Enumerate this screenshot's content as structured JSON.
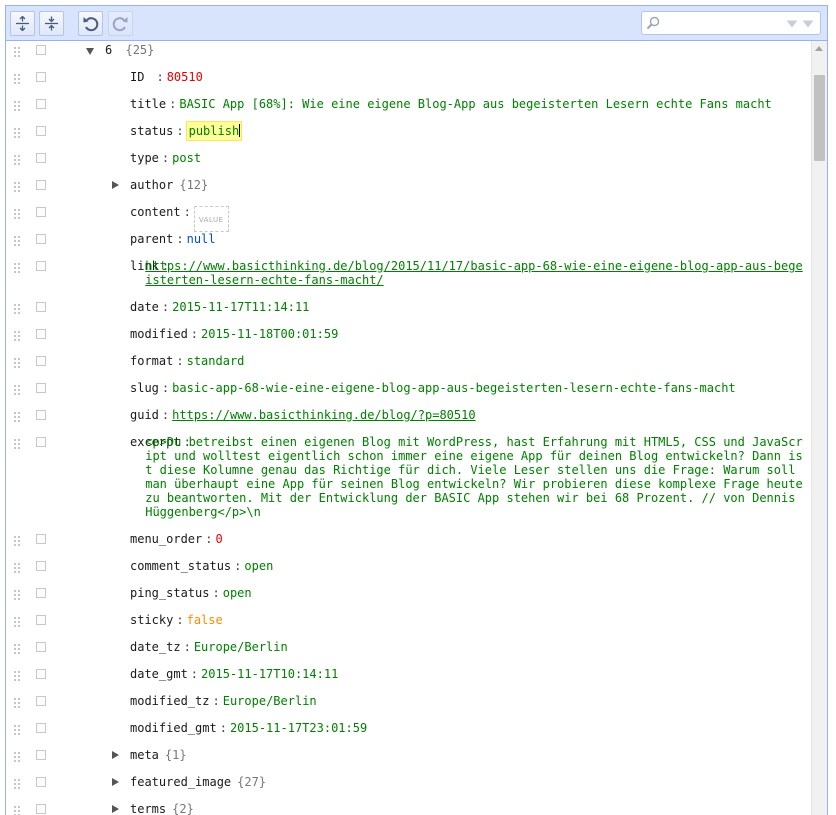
{
  "toolbar": {
    "expand_all_icon": "expand-all-icon",
    "collapse_all_icon": "collapse-all-icon",
    "undo_icon": "undo-icon",
    "redo_icon": "redo-icon"
  },
  "search": {
    "value": "",
    "placeholder": ""
  },
  "node": {
    "index": "6",
    "count": "{25}"
  },
  "fields": [
    {
      "key": "ID",
      "type": "number",
      "value": "80510"
    },
    {
      "key": "title",
      "type": "string",
      "value": "BASIC App [68%]: Wie eine eigene Blog-App aus begeisterten Lesern echte Fans macht"
    },
    {
      "key": "status",
      "type": "string",
      "value": "publish",
      "highlight": true
    },
    {
      "key": "type",
      "type": "string",
      "value": "post"
    },
    {
      "key": "author",
      "type": "object",
      "count": "{12}"
    },
    {
      "key": "content",
      "type": "empty",
      "value": "VALUE"
    },
    {
      "key": "parent",
      "type": "null",
      "value": "null"
    },
    {
      "key": "link",
      "type": "url",
      "value": "https://www.basicthinking.de/blog/2015/11/17/basic-app-68-wie-eine-eigene-blog-app-aus-begeisterten-lesern-echte-fans-macht/",
      "lines": 2
    },
    {
      "key": "date",
      "type": "string",
      "value": "2015-11-17T11:14:11"
    },
    {
      "key": "modified",
      "type": "string",
      "value": "2015-11-18T00:01:59"
    },
    {
      "key": "format",
      "type": "string",
      "value": "standard"
    },
    {
      "key": "slug",
      "type": "string",
      "value": "basic-app-68-wie-eine-eigene-blog-app-aus-begeisterten-lesern-echte-fans-macht"
    },
    {
      "key": "guid",
      "type": "url",
      "value": "https://www.basicthinking.de/blog/?p=80510"
    },
    {
      "key": "excerpt",
      "type": "string",
      "value": "<p>Du betreibst einen eigenen Blog mit WordPress, hast Erfahrung mit HTML5, CSS und JavaScript und wolltest eigentlich schon immer eine eigene App für deinen Blog entwickeln? Dann ist diese Kolumne genau das Richtige für dich. Viele Leser stellen uns die Frage: Warum soll man überhaupt eine App für seinen Blog entwickeln?  Wir probieren diese komplexe Frage heute zu beantworten. Mit der Entwicklung der BASIC App stehen wir bei 68 Prozent. // von Dennis Hüggenberg</p>\\n",
      "lines": 6
    },
    {
      "key": "menu_order",
      "type": "number",
      "value": "0"
    },
    {
      "key": "comment_status",
      "type": "string",
      "value": "open"
    },
    {
      "key": "ping_status",
      "type": "string",
      "value": "open"
    },
    {
      "key": "sticky",
      "type": "boolean",
      "value": "false"
    },
    {
      "key": "date_tz",
      "type": "string",
      "value": "Europe/Berlin"
    },
    {
      "key": "date_gmt",
      "type": "string",
      "value": "2015-11-17T10:14:11"
    },
    {
      "key": "modified_tz",
      "type": "string",
      "value": "Europe/Berlin"
    },
    {
      "key": "modified_gmt",
      "type": "string",
      "value": "2015-11-17T23:01:59"
    },
    {
      "key": "meta",
      "type": "object",
      "count": "{1}"
    },
    {
      "key": "featured_image",
      "type": "object",
      "count": "{27}"
    },
    {
      "key": "terms",
      "type": "object",
      "count": "{2}"
    }
  ],
  "colors": {
    "string": "#008000",
    "number": "#ee0000",
    "boolean": "#ff8c00",
    "null": "#004ed0",
    "menu_bg": "#d8e3fc",
    "border": "#97b0f8",
    "highlight": "#ffff99"
  }
}
